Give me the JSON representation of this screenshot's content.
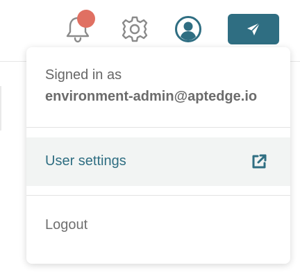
{
  "header": {
    "icons": [
      "bell-icon",
      "gear-icon",
      "user-circle-icon",
      "paper-plane-icon"
    ],
    "notification_badge_color": "#e07062",
    "accent": "#2f6e82"
  },
  "account_menu": {
    "signed_in_label": "Signed in as",
    "email": "environment-admin@aptedge.io",
    "user_settings_label": "User settings",
    "logout_label": "Logout",
    "external_link_icon": "external-link-icon"
  }
}
